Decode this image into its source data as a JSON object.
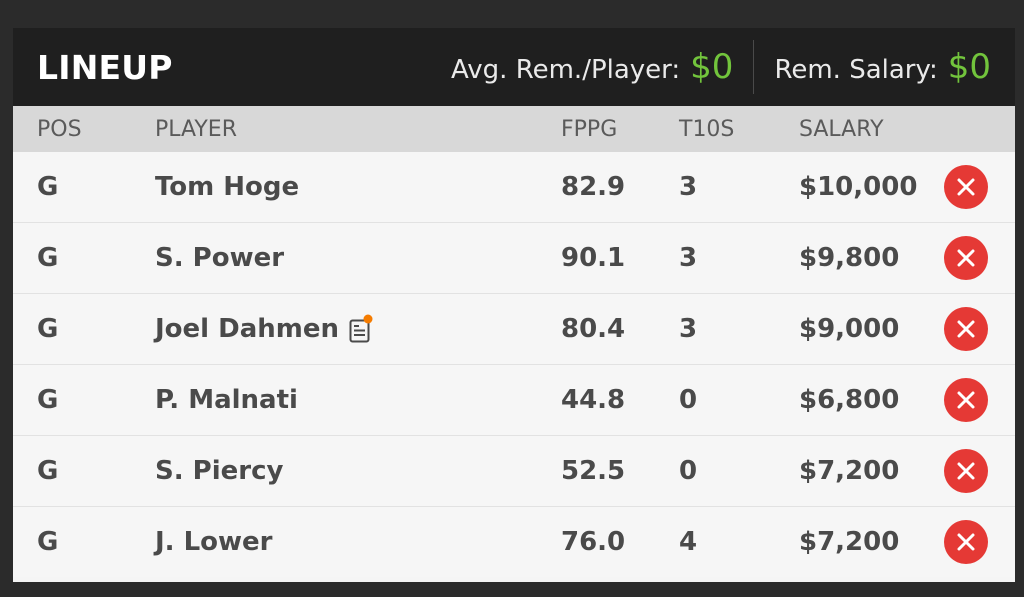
{
  "header": {
    "title": "LINEUP",
    "avg_label": "Avg. Rem./Player:",
    "avg_value": "$0",
    "rem_label": "Rem. Salary:",
    "rem_value": "$0"
  },
  "columns": {
    "pos": "POS",
    "player": "PLAYER",
    "fppg": "FPPG",
    "t10s": "T10S",
    "salary": "SALARY"
  },
  "rows": [
    {
      "pos": "G",
      "player": "Tom Hoge",
      "fppg": "82.9",
      "t10s": "3",
      "salary": "$10,000",
      "news": false
    },
    {
      "pos": "G",
      "player": "S. Power",
      "fppg": "90.1",
      "t10s": "3",
      "salary": "$9,800",
      "news": false
    },
    {
      "pos": "G",
      "player": "Joel Dahmen",
      "fppg": "80.4",
      "t10s": "3",
      "salary": "$9,000",
      "news": true
    },
    {
      "pos": "G",
      "player": "P. Malnati",
      "fppg": "44.8",
      "t10s": "0",
      "salary": "$6,800",
      "news": false
    },
    {
      "pos": "G",
      "player": "S. Piercy",
      "fppg": "52.5",
      "t10s": "0",
      "salary": "$7,200",
      "news": false
    },
    {
      "pos": "G",
      "player": "J. Lower",
      "fppg": "76.0",
      "t10s": "4",
      "salary": "$7,200",
      "news": false
    }
  ],
  "icons": {
    "remove": "close-circle-icon",
    "news": "player-news-icon"
  },
  "colors": {
    "accent_green": "#72c43c",
    "remove_red": "#e53935",
    "news_dot": "#f57c00"
  }
}
